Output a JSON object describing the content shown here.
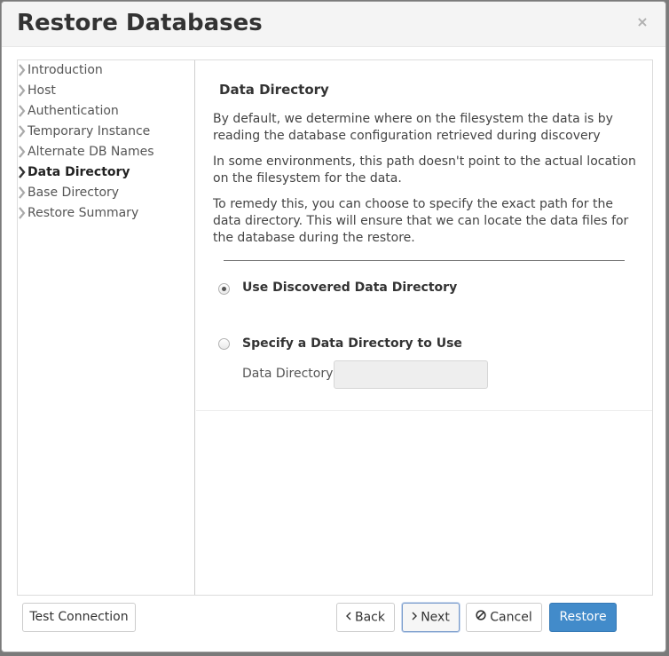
{
  "dialog": {
    "title": "Restore Databases",
    "close_glyph": "×"
  },
  "steps": [
    {
      "label": "Introduction",
      "active": false
    },
    {
      "label": "Host",
      "active": false
    },
    {
      "label": "Authentication",
      "active": false
    },
    {
      "label": "Temporary Instance",
      "active": false
    },
    {
      "label": "Alternate DB Names",
      "active": false
    },
    {
      "label": "Data Directory",
      "active": true
    },
    {
      "label": "Base Directory",
      "active": false
    },
    {
      "label": "Restore Summary",
      "active": false
    }
  ],
  "panel": {
    "heading": "Data Directory",
    "paragraphs": [
      "By default, we determine where on the filesystem the data is by reading the database configuration retrieved during discovery",
      "In some environments, this path doesn't point to the actual location on the filesystem for the data.",
      "To remedy this, you can choose to specify the exact path for the data directory. This will ensure that we can locate the data files for the database during the restore."
    ],
    "options": [
      {
        "label": "Use Discovered Data Directory",
        "checked": true
      },
      {
        "label": "Specify a Data Directory to Use",
        "checked": false
      }
    ],
    "data_directory": {
      "label": "Data Directory",
      "value": "",
      "placeholder": ""
    }
  },
  "footer": {
    "test_connection": "Test Connection",
    "back": "Back",
    "next": "Next",
    "cancel": "Cancel",
    "restore": "Restore"
  },
  "icons": {
    "step_chevron": "chevron-right-icon",
    "back": "chevron-left-icon",
    "next": "chevron-right-icon",
    "cancel": "ban-icon"
  },
  "colors": {
    "primary": "#428bca",
    "header_bg": "#f4f4f4"
  }
}
